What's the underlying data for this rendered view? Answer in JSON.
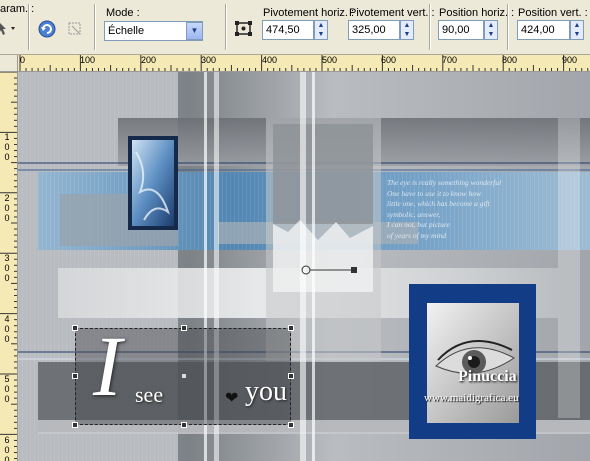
{
  "toolbar": {
    "param_label": "aram. :",
    "mode_label": "Mode :",
    "mode_value": "Échelle",
    "pivot_h_label": "Pivotement horiz. :",
    "pivot_h_value": "474,50",
    "pivot_v_label": "Pivotement vert. :",
    "pivot_v_value": "325,00",
    "pos_h_label": "Position horiz. :",
    "pos_h_value": "90,00",
    "pos_v_label": "Position vert. :",
    "pos_v_value": "424,00"
  },
  "ruler": {
    "h_labels": [
      "0",
      "100",
      "200",
      "300",
      "400",
      "500",
      "600",
      "700",
      "800",
      "900"
    ],
    "v_labels": [
      "1",
      "0",
      "0",
      "2",
      "0",
      "0",
      "3",
      "0",
      "0",
      "4",
      "0",
      "0",
      "5",
      "0",
      "0",
      "6",
      "0",
      "0"
    ]
  },
  "artwork": {
    "poem_lines": [
      "The eye is really something wonderful",
      "One have to use it to know how",
      "little one, which has become a gift",
      "symbolic, answer,",
      "I can not, but picture",
      "of years of my mind"
    ],
    "big_letter": "I",
    "word_see": "see",
    "heart": "❤",
    "word_you": "you",
    "signature": "Pinuccia",
    "website": "www.maidigrafica.eu"
  },
  "colors": {
    "toolbar_bg": "#ece9d8",
    "ruler_bg": "#f5e9b5",
    "field_border": "#7f9db9",
    "accent_blue": "#1b4f9a"
  }
}
